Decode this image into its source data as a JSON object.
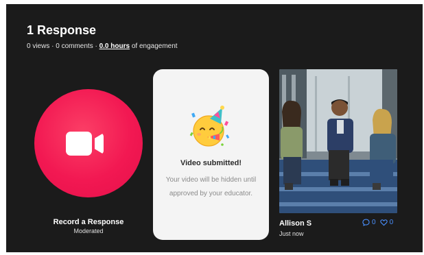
{
  "header": {
    "title": "1 Response",
    "meta_prefix": "0 views · 0 comments · ",
    "meta_hours": "0.0 hours",
    "meta_suffix": " of engagement"
  },
  "record": {
    "label": "Record a Response",
    "sublabel": "Moderated"
  },
  "submitted": {
    "title": "Video submitted!",
    "message": "Your video will be hidden until approved by your educator."
  },
  "response": {
    "author": "Allison S",
    "timestamp": "Just now",
    "comment_count": "0",
    "like_count": "0"
  },
  "colors": {
    "panel_bg": "#1b1b1b",
    "record_red": "#f21852",
    "accent_blue": "#4a90ff"
  }
}
